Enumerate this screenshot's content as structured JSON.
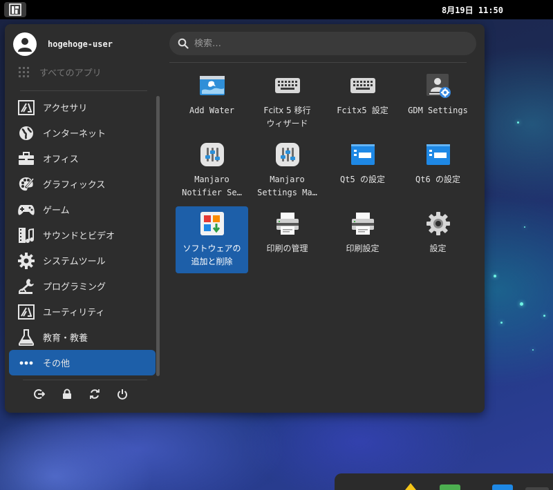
{
  "topbar": {
    "clock": "8月19日 11:50"
  },
  "user": {
    "name": "hogehoge-user"
  },
  "search": {
    "placeholder": "検索…"
  },
  "sidebar": {
    "all_apps_label": "すべてのアプリ",
    "categories": [
      {
        "label": "アクセサリ",
        "icon": "accessories-icon"
      },
      {
        "label": "インターネット",
        "icon": "globe-icon"
      },
      {
        "label": "オフィス",
        "icon": "briefcase-icon"
      },
      {
        "label": "グラフィックス",
        "icon": "palette-icon"
      },
      {
        "label": "ゲーム",
        "icon": "gamepad-icon"
      },
      {
        "label": "サウンドとビデオ",
        "icon": "film-music-icon"
      },
      {
        "label": "システムツール",
        "icon": "gear-icon"
      },
      {
        "label": "プログラミング",
        "icon": "wrench-icon"
      },
      {
        "label": "ユーティリティ",
        "icon": "utilities-icon"
      },
      {
        "label": "教育・教養",
        "icon": "flask-icon"
      },
      {
        "label": "その他",
        "icon": "more-icon",
        "active": true
      }
    ]
  },
  "session_actions": [
    "logout-icon",
    "lock-icon",
    "restart-icon",
    "power-icon"
  ],
  "apps": [
    {
      "line1": "Add Water",
      "line2": "",
      "icon": "add-water-icon"
    },
    {
      "line1": "Fcitx 5 移行",
      "line2": "ウィザード",
      "icon": "keyboard-icon"
    },
    {
      "line1": "Fcitx5 設定",
      "line2": "",
      "icon": "keyboard-icon"
    },
    {
      "line1": "GDM Settings",
      "line2": "",
      "icon": "gdm-settings-icon"
    },
    {
      "line1": "Manjaro",
      "line2": "Notifier Se…",
      "icon": "manjaro-settings-icon"
    },
    {
      "line1": "Manjaro",
      "line2": "Settings Ma…",
      "icon": "manjaro-settings-icon"
    },
    {
      "line1": "Qt5 の設定",
      "line2": "",
      "icon": "qt-settings-icon"
    },
    {
      "line1": "Qt6 の設定",
      "line2": "",
      "icon": "qt-settings-icon"
    },
    {
      "line1": "ソフトウェアの",
      "line2": "追加と削除",
      "icon": "software-add-remove-icon",
      "selected": true
    },
    {
      "line1": "印刷の管理",
      "line2": "",
      "icon": "printer-icon"
    },
    {
      "line1": "印刷設定",
      "line2": "",
      "icon": "printer-icon"
    },
    {
      "line1": "設定",
      "line2": "",
      "icon": "settings-gear-icon"
    }
  ],
  "colors": {
    "accent": "#1d5fa9",
    "panel": "#2d2d2d",
    "topbar": "#000000"
  }
}
